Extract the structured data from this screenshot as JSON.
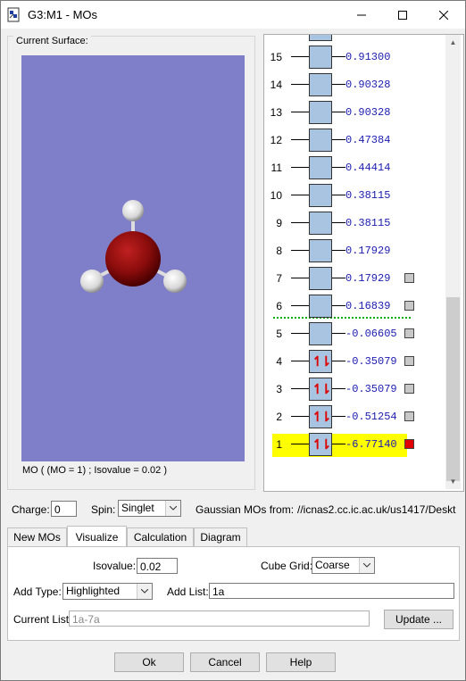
{
  "window": {
    "title": "G3:M1 - MOs",
    "minimize": "—",
    "maximize": "☐",
    "close": "✕"
  },
  "surface": {
    "group_label": "Current Surface:",
    "caption": "MO ( (MO = 1) ; Isovalue = 0.02 )",
    "background": "#7f7fc9"
  },
  "orbitals": [
    {
      "num": "15",
      "energy": " 0.91300",
      "occupied": false,
      "selectable": false
    },
    {
      "num": "14",
      "energy": " 0.90328",
      "occupied": false,
      "selectable": false
    },
    {
      "num": "13",
      "energy": " 0.90328",
      "occupied": false,
      "selectable": false
    },
    {
      "num": "12",
      "energy": " 0.47384",
      "occupied": false,
      "selectable": false
    },
    {
      "num": "11",
      "energy": " 0.44414",
      "occupied": false,
      "selectable": false
    },
    {
      "num": "10",
      "energy": " 0.38115",
      "occupied": false,
      "selectable": false
    },
    {
      "num": "9",
      "energy": " 0.38115",
      "occupied": false,
      "selectable": false
    },
    {
      "num": "8",
      "energy": " 0.17929",
      "occupied": false,
      "selectable": false
    },
    {
      "num": "7",
      "energy": " 0.17929",
      "occupied": false,
      "selectable": true
    },
    {
      "num": "6",
      "energy": " 0.16839",
      "occupied": false,
      "selectable": true
    },
    {
      "num": "5",
      "energy": "-0.06605",
      "occupied": false,
      "selectable": true
    },
    {
      "num": "4",
      "energy": "-0.35079",
      "occupied": true,
      "selectable": true
    },
    {
      "num": "3",
      "energy": "-0.35079",
      "occupied": true,
      "selectable": true
    },
    {
      "num": "2",
      "energy": "-0.51254",
      "occupied": true,
      "selectable": true
    },
    {
      "num": "1",
      "energy": "-6.77140",
      "occupied": true,
      "selectable": true,
      "highlighted": true
    }
  ],
  "spin_glyph": "↿⇂",
  "controls": {
    "charge_label": "Charge:",
    "charge_value": "0",
    "spin_label": "Spin:",
    "spin_value": "Singlet",
    "source_label": "Gaussian MOs from:",
    "source_path": "//icnas2.cc.ic.ac.uk/us1417/Deskt"
  },
  "tabs": [
    "New MOs",
    "Visualize",
    "Calculation",
    "Diagram"
  ],
  "visualize": {
    "isovalue_label": "Isovalue:",
    "isovalue": "0.02",
    "cube_grid_label": "Cube Grid:",
    "cube_grid": "Coarse",
    "add_type_label": "Add Type:",
    "add_type": "Highlighted",
    "add_list_label": "Add List:",
    "add_list": "1a",
    "current_list_label": "Current List:",
    "current_list": "1a-7a",
    "update_button": "Update ..."
  },
  "buttons": {
    "ok": "Ok",
    "cancel": "Cancel",
    "help": "Help"
  }
}
